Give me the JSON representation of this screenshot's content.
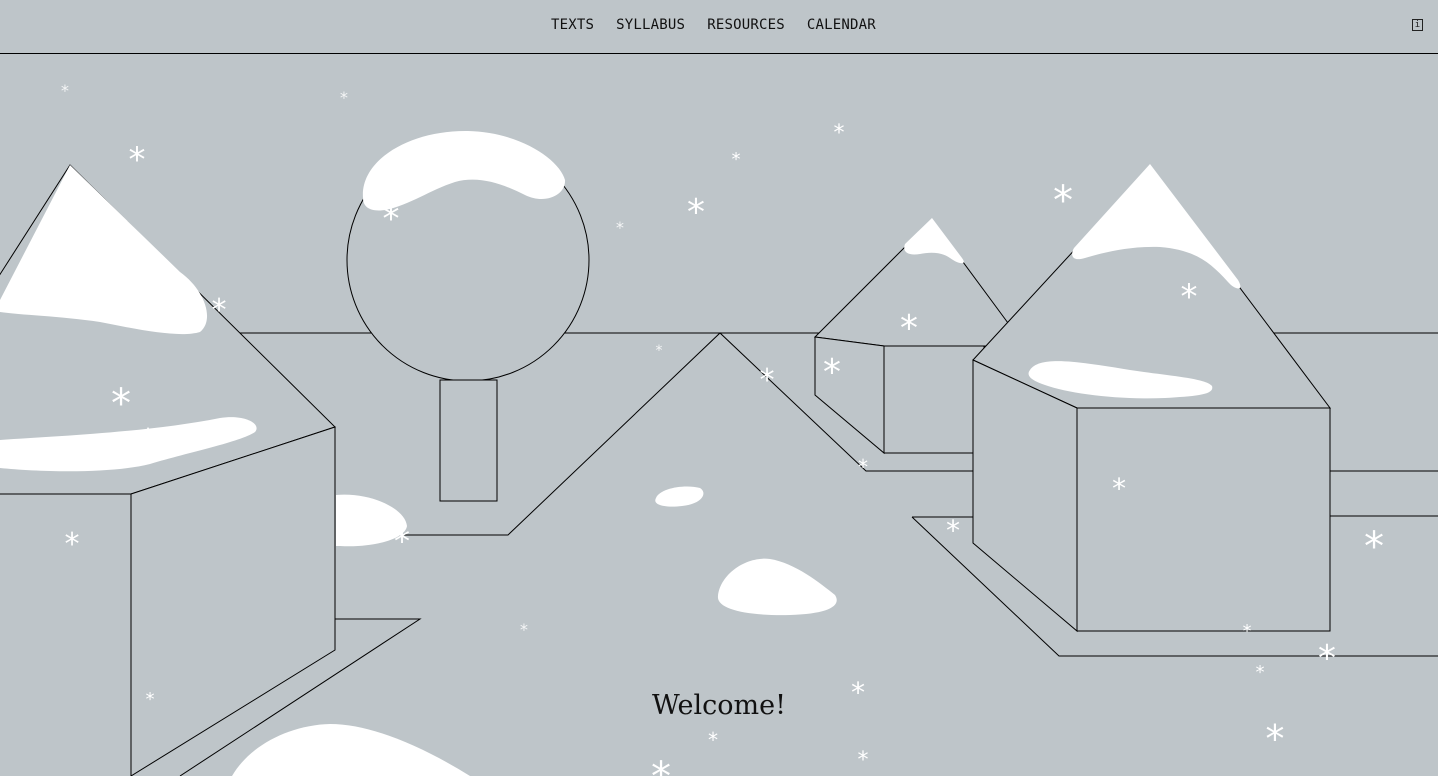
{
  "nav": {
    "items": [
      {
        "label": "TEXTS"
      },
      {
        "label": "SYLLABUS"
      },
      {
        "label": "RESOURCES"
      },
      {
        "label": "CALENDAR"
      }
    ],
    "info_icon": "info-icon",
    "info_glyph": "i"
  },
  "main": {
    "welcome": "Welcome!"
  },
  "colors": {
    "background": "#bec5c9",
    "snow": "#ffffff",
    "line": "#000000"
  }
}
